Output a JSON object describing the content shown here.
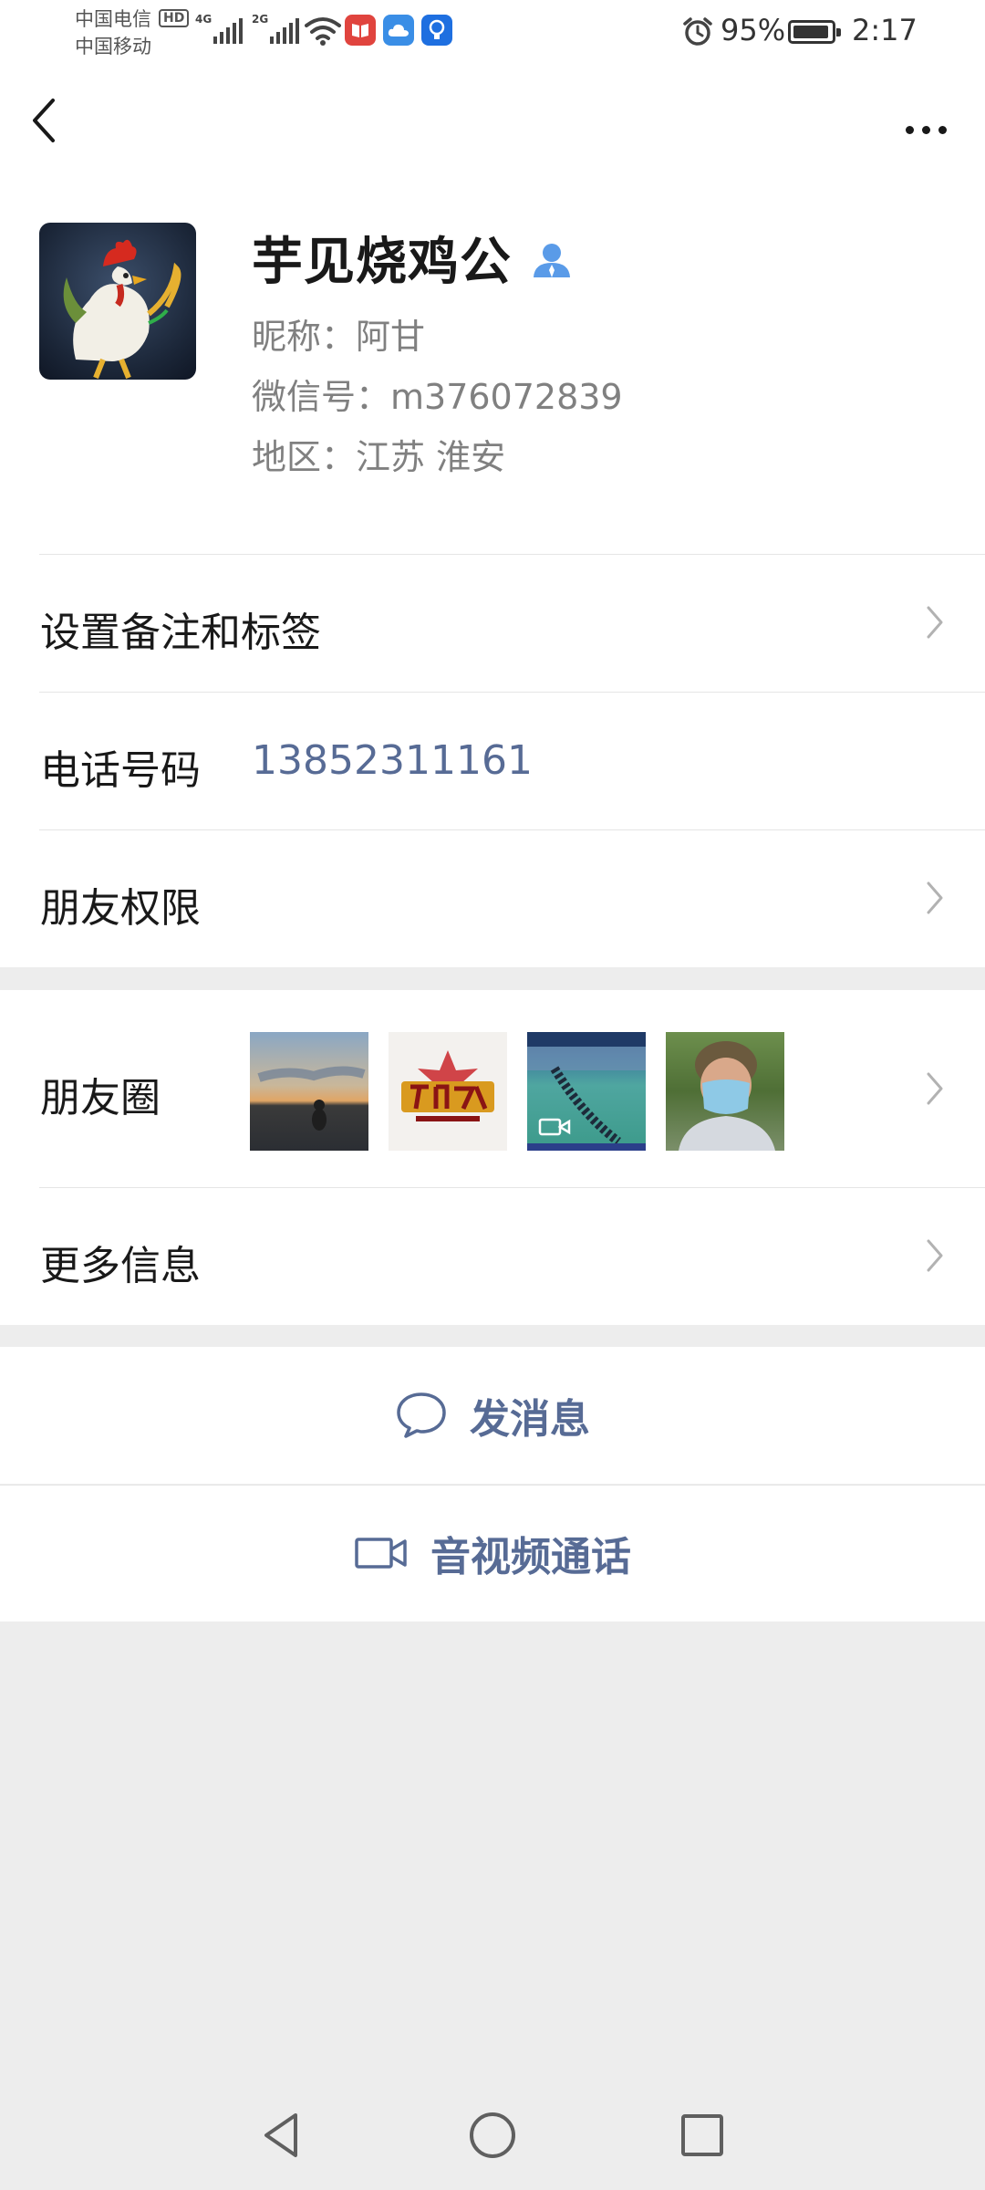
{
  "status_bar": {
    "carrier1": "中国电信",
    "carrier2": "中国移动",
    "hd_badge": "HD",
    "signal1_type": "4G",
    "signal2_type": "2G",
    "battery_percent": "95%",
    "battery_level": 0.95,
    "time": "2:17",
    "app_icons": [
      "book-icon",
      "cloud-icon",
      "bulb-icon"
    ],
    "app_icon_colors": [
      "#e0443e",
      "#3a8ee6",
      "#1e6fe0"
    ]
  },
  "nav": {
    "back_icon": "chevron-left-icon",
    "more_icon": "more-dots-icon"
  },
  "profile": {
    "display_name": "芋见烧鸡公",
    "nickname": "昵称：阿甘",
    "wechat_id": "微信号：m376072839",
    "region": "地区：江苏  淮安",
    "avatar": "rooster-avatar",
    "contact_icon": "person-icon",
    "contact_icon_color": "#5a9be8"
  },
  "rows": {
    "remark": "设置备注和标签",
    "phone_label": "电话号码",
    "phone_value": "13852311161",
    "permissions": "朋友权限",
    "moments": "朋友圈",
    "more_info": "更多信息"
  },
  "moments_thumbs": [
    "sunset-photo",
    "recruitment-poster",
    "basketball-court-video",
    "man-with-mask-photo"
  ],
  "actions": {
    "message": "发消息",
    "message_icon": "chat-bubble-icon",
    "video_call": "音视频通话",
    "video_icon": "video-camera-icon"
  },
  "colors": {
    "link_blue": "#576b95",
    "background": "#ededed"
  },
  "system_nav": [
    "back-triangle-icon",
    "home-circle-icon",
    "recents-square-icon"
  ]
}
